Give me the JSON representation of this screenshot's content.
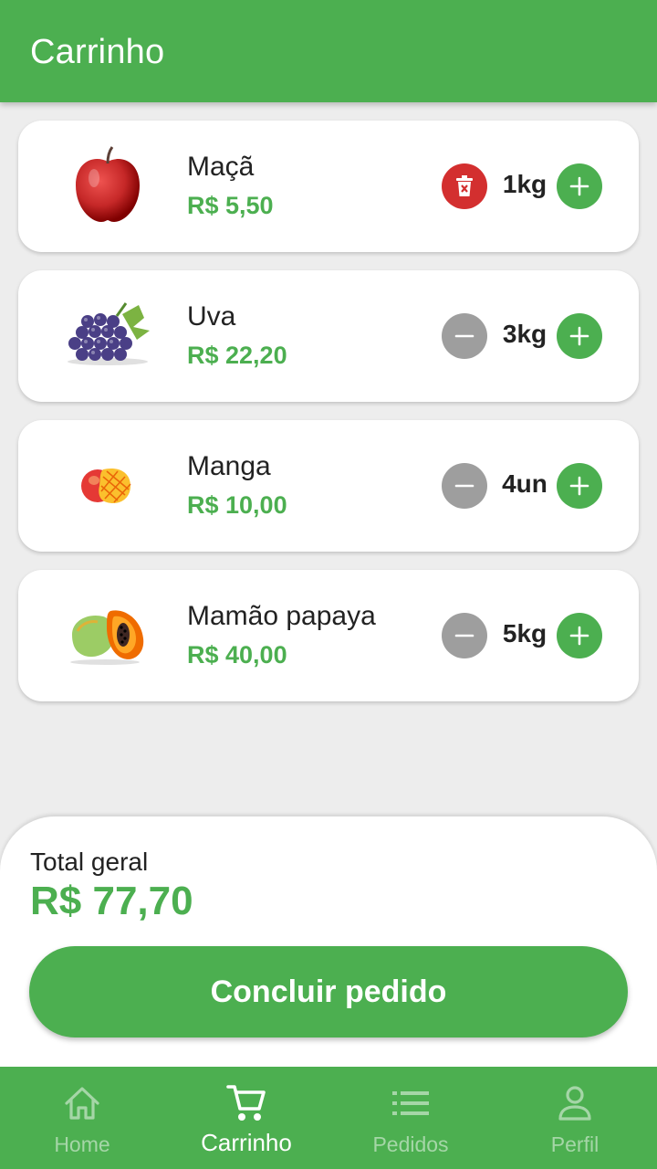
{
  "appbar": {
    "title": "Carrinho"
  },
  "cart": {
    "items": [
      {
        "name": "Maçã",
        "price": "R$ 5,50",
        "quantity": "1kg",
        "image": "apple",
        "decrement_action": "delete"
      },
      {
        "name": "Uva",
        "price": "R$ 22,20",
        "quantity": "3kg",
        "image": "grapes",
        "decrement_action": "minus"
      },
      {
        "name": "Manga",
        "price": "R$ 10,00",
        "quantity": "4un",
        "image": "mango",
        "decrement_action": "minus"
      },
      {
        "name": "Mamão papaya",
        "price": "R$ 40,00",
        "quantity": "5kg",
        "image": "papaya",
        "decrement_action": "minus"
      }
    ]
  },
  "summary": {
    "total_label": "Total geral",
    "total_value": "R$ 77,70",
    "checkout_label": "Concluir pedido"
  },
  "nav": {
    "items": [
      {
        "label": "Home",
        "icon": "home-icon",
        "active": false
      },
      {
        "label": "Carrinho",
        "icon": "cart-icon",
        "active": true
      },
      {
        "label": "Pedidos",
        "icon": "list-icon",
        "active": false
      },
      {
        "label": "Perfil",
        "icon": "person-icon",
        "active": false
      }
    ]
  },
  "colors": {
    "primary": "#4caf50",
    "delete": "#d32f2f",
    "neutral_button": "#9e9e9e",
    "background": "#ededed"
  }
}
